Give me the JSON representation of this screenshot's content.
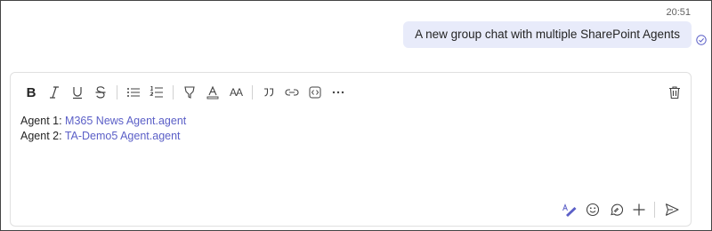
{
  "message": {
    "timestamp": "20:51",
    "text": "A new group chat with multiple SharePoint Agents",
    "status_icon": "sent-check-icon"
  },
  "composer": {
    "toolbar": {
      "bold": "B",
      "heading_size": "AA",
      "icons": [
        "bold-icon",
        "italic-icon",
        "underline-icon",
        "strikethrough-icon",
        "bulleted-list-icon",
        "numbered-list-icon",
        "highlight-icon",
        "font-color-icon",
        "font-size-icon",
        "quote-icon",
        "link-icon",
        "code-snippet-icon",
        "more-options-icon"
      ],
      "delete_icon": "trash-icon"
    },
    "lines": [
      {
        "prefix": "Agent 1: ",
        "link": "M365 News Agent.agent"
      },
      {
        "prefix": "Agent 2: ",
        "link": "TA-Demo5 Agent.agent"
      }
    ],
    "bottom_icons": [
      "format-icon",
      "emoji-icon",
      "loop-icon",
      "attach-plus-icon",
      "send-icon"
    ]
  },
  "colors": {
    "bubble_bg": "#e8ebfa",
    "link": "#5b5fc7",
    "accent": "#5b5fc7"
  }
}
